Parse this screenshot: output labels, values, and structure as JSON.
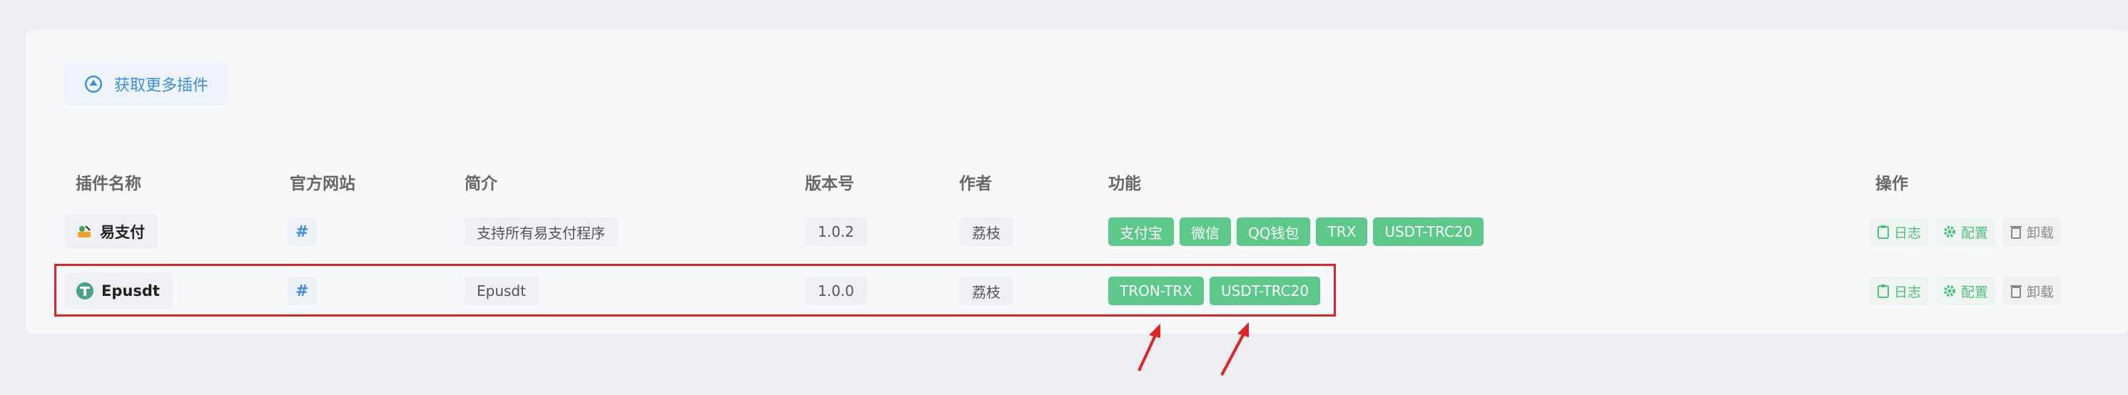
{
  "toolbar": {
    "get_more_label": "获取更多插件"
  },
  "columns": {
    "name": "插件名称",
    "website": "官方网站",
    "intro": "简介",
    "version": "版本号",
    "author": "作者",
    "features": "功能",
    "actions": "操作"
  },
  "rows": [
    {
      "name": "易支付",
      "website": "#",
      "intro": "支持所有易支付程序",
      "version": "1.0.2",
      "author": "荔枝",
      "features": [
        "支付宝",
        "微信",
        "QQ钱包",
        "TRX",
        "USDT-TRC20"
      ],
      "actions": {
        "log": "日志",
        "config": "配置",
        "uninstall": "卸载"
      }
    },
    {
      "name": "Epusdt",
      "website": "#",
      "intro": "Epusdt",
      "version": "1.0.0",
      "author": "荔枝",
      "features": [
        "TRON-TRX",
        "USDT-TRC20"
      ],
      "actions": {
        "log": "日志",
        "config": "配置",
        "uninstall": "卸载"
      }
    }
  ],
  "colors": {
    "tag_green": "#5cc98a",
    "link_blue": "#3a8ee6",
    "highlight_red": "#e02424"
  },
  "icons": [
    "plugin-store-icon",
    "yipay-logo-icon",
    "tether-logo-icon",
    "clipboard-icon",
    "gear-icon",
    "trash-icon",
    "red-arrow-annotation"
  ]
}
